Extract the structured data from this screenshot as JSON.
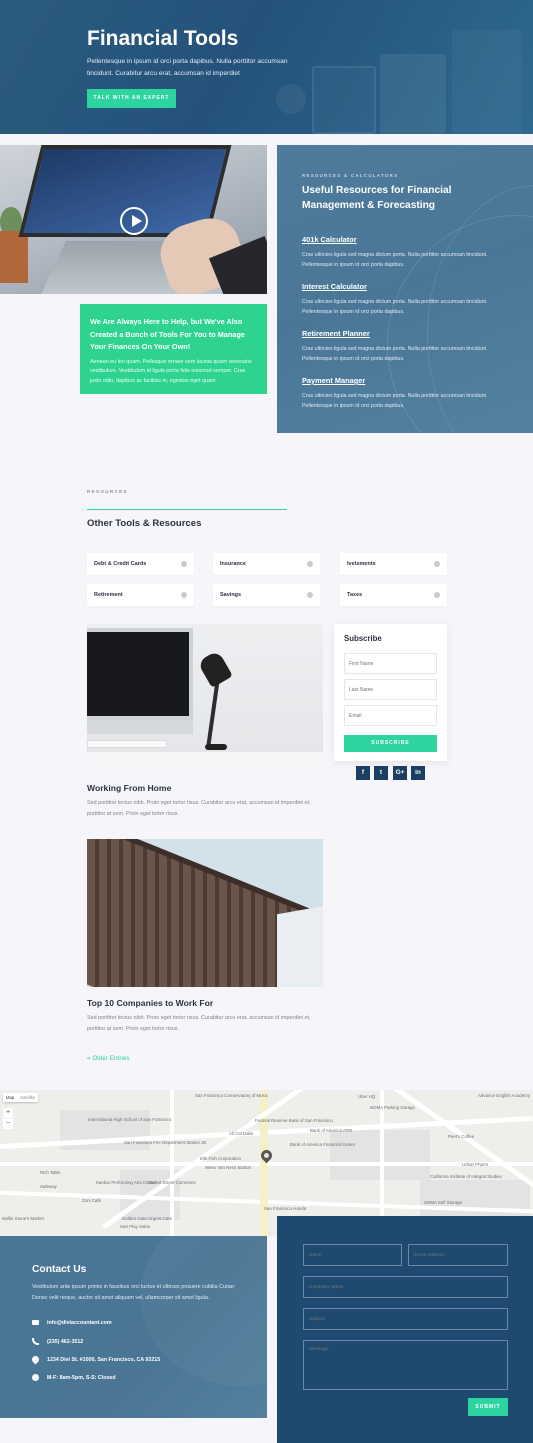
{
  "hero": {
    "title": "Financial Tools",
    "subtitle": "Pellentesque in ipsum id orci porta dapibus. Nulla porttitor accumsan tincidunt. Curabitur arcu erat, accumsan id imperdiet",
    "button_label": "TALK WITH AN EXPERT"
  },
  "help_card": {
    "title": "We Are Always Here to Help, but We've Also Created a Bunch of Tools For You to Manage Your Finances On Your Own!",
    "text": "Aenean eu leo quam. Pellesque ornare sem lacinia quam venenatis vestibulum. Vestibulum id ligula porta felis euismod semper. Cras justo odio, dapibus ac facilisis in, egestas eget quam."
  },
  "resources": {
    "eyebrow": "RESOURCES & CALCULATORS",
    "title": "Useful Resources for Financial Management & Forecasting",
    "items": [
      {
        "title": "401k Calculator",
        "text": "Cras ultricies ligula sed magna dictum porta. Nulla porttitor accumsan tincidunt. Pellentesque in ipsum id orci porta dapibus."
      },
      {
        "title": "Interest Calculator",
        "text": "Cras ultricies ligula sed magna dictum porta. Nulla porttitor accumsan tincidunt. Pellentesque in ipsum id orci porta dapibus."
      },
      {
        "title": "Retirement Planner",
        "text": "Cras ultricies ligula sed magna dictum porta. Nulla porttitor accumsan tincidunt. Pellentesque in ipsum id orci porta dapibus."
      },
      {
        "title": "Payment Manager",
        "text": "Cras ultricies ligula sed magna dictum porta. Nulla porttitor accumsan tincidunt. Pellentesque in ipsum id orci porta dapibus."
      }
    ]
  },
  "tools": {
    "eyebrow": "RESOURCES",
    "title": "Other Tools & Resources",
    "items": [
      "Debt & Credit Cards",
      "Insurance",
      "Ivetsments",
      "Retirement",
      "Savings",
      "Taxes"
    ]
  },
  "posts": [
    {
      "title": "Working From Home",
      "text": "Sed porttitor lectus nibh. Proin eget tortor risus. Curabitur arcu erat, accumsan id imperdiet et, porttitor at sem. Proin eget tortor risus."
    },
    {
      "title": "Top 10 Companies to Work For",
      "text": "Sed porttitor lectus nibh. Proin eget tortor risus. Curabitur arcu erat, accumsan id imperdiet et, porttitor at sem. Proin eget tortor risus."
    }
  ],
  "older_entries": "« Older Entries",
  "subscribe": {
    "title": "Subscribe",
    "first_name": "First Name",
    "last_name": "Last Name",
    "email": "Email",
    "button": "SUBSCRIBE"
  },
  "social": [
    "f",
    "t",
    "G+",
    "in"
  ],
  "map": {
    "tab_map": "Map",
    "tab_satellite": "Satellite",
    "labels": [
      "San Francisco Conservatory of Music",
      "Uber HQ",
      "Advance English Academy",
      "NOMA Parking Garage",
      "Federal Reserve Bank of San Francisco",
      "International High School of San Francisco",
      "Bank of America ATM",
      "Bank of America Financial Center",
      "Peet's Coffee",
      "San Francisco Fire Department Station 36",
      "All Cal Dalla",
      "Elle Fish Corporation",
      "Metro Van Ness Station",
      "Rich Table",
      "Urban Pharm",
      "Market Street Commons",
      "Kanbar Performing Arts Center",
      "California Institute of Integral Studies",
      "Safeway",
      "Zuni Café",
      "Golden Gate Urgent Care",
      "SOMA Self Storage",
      "Hair Play Salon",
      "San Francisco Honda",
      "Mollie Stone's Market"
    ],
    "zoom_in": "+",
    "zoom_out": "−"
  },
  "contact": {
    "title": "Contact Us",
    "text": "Vestibulum ante ipsum primis in faucibus orci luctus et ultrices posuere cubilia Curae; Donec velit neque, auctor sit amet aliquam vel, ullamcorper sit amet ligula.",
    "email": "info@diviaccountant.com",
    "phone": "(235) 462-3512",
    "address": "1234 Divi St. #1000, San Francisco, CA 93215",
    "hours": "M-F: 8am-5pm, S-S: Closed"
  },
  "contact_form": {
    "name": "Name",
    "email": "Email Address",
    "company": "Company Name",
    "subject": "Subject",
    "message": "Message",
    "submit": "SUBMIT"
  }
}
